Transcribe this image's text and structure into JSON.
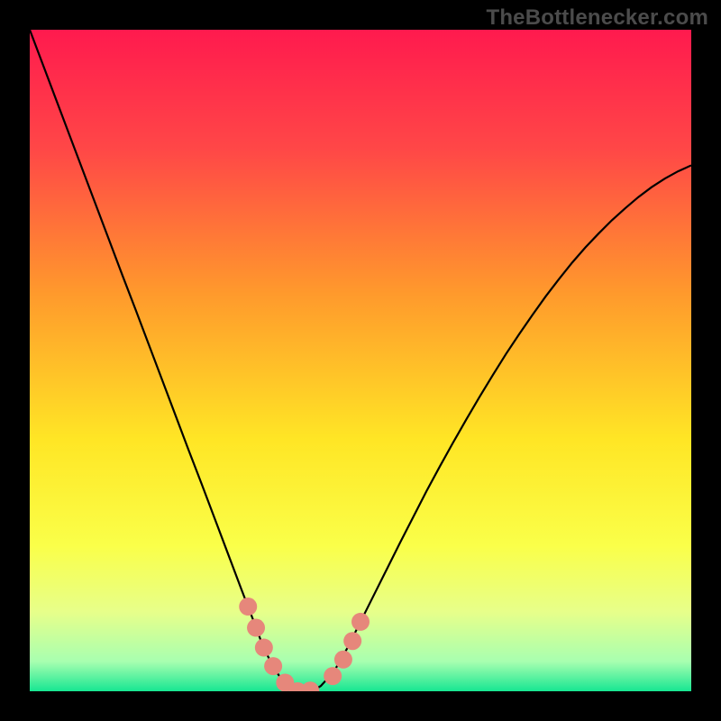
{
  "watermark": "TheBottlenecker.com",
  "chart_data": {
    "type": "line",
    "title": "",
    "xlabel": "",
    "ylabel": "",
    "xlim": [
      0,
      100
    ],
    "ylim": [
      0,
      100
    ],
    "grid": false,
    "legend": false,
    "background_gradient": {
      "stops": [
        {
          "offset": 0.0,
          "color": "#ff1a4e"
        },
        {
          "offset": 0.18,
          "color": "#ff4747"
        },
        {
          "offset": 0.4,
          "color": "#ff9a2c"
        },
        {
          "offset": 0.62,
          "color": "#ffe625"
        },
        {
          "offset": 0.78,
          "color": "#faff49"
        },
        {
          "offset": 0.88,
          "color": "#e7ff8a"
        },
        {
          "offset": 0.955,
          "color": "#a8ffb0"
        },
        {
          "offset": 1.0,
          "color": "#17e692"
        }
      ]
    },
    "series": [
      {
        "name": "bottleneck-curve",
        "color": "#000000",
        "width": 2.2,
        "x": [
          0,
          2,
          4,
          6,
          8,
          10,
          12,
          14,
          16,
          18,
          20,
          22,
          24,
          26,
          28,
          30,
          32,
          34,
          35,
          36,
          37,
          38,
          39,
          40,
          41,
          42,
          43,
          44,
          46,
          48,
          50,
          52,
          54,
          56,
          58,
          60,
          62,
          64,
          66,
          68,
          70,
          72,
          74,
          76,
          78,
          80,
          82,
          84,
          86,
          88,
          90,
          92,
          94,
          96,
          98,
          100
        ],
        "y": [
          100,
          94.7,
          89.4,
          84.1,
          78.8,
          73.5,
          68.2,
          62.9,
          57.7,
          52.4,
          47.1,
          41.8,
          36.5,
          31.3,
          26.0,
          20.7,
          15.4,
          10.2,
          7.5,
          5.3,
          3.4,
          1.9,
          0.8,
          0.2,
          0.0,
          0.0,
          0.2,
          0.8,
          3.0,
          6.5,
          10.5,
          14.5,
          18.5,
          22.5,
          26.4,
          30.3,
          34.0,
          37.6,
          41.1,
          44.5,
          47.8,
          51.0,
          54.0,
          56.9,
          59.7,
          62.3,
          64.8,
          67.1,
          69.2,
          71.2,
          73.0,
          74.7,
          76.2,
          77.5,
          78.6,
          79.5
        ]
      }
    ],
    "markers": {
      "name": "salmon-dots",
      "color": "#e6877b",
      "radius": 10,
      "points": [
        {
          "x": 33.0,
          "y": 12.8
        },
        {
          "x": 34.2,
          "y": 9.6
        },
        {
          "x": 35.4,
          "y": 6.6
        },
        {
          "x": 36.8,
          "y": 3.8
        },
        {
          "x": 38.6,
          "y": 1.3
        },
        {
          "x": 40.5,
          "y": 0.0
        },
        {
          "x": 42.4,
          "y": 0.1
        },
        {
          "x": 45.8,
          "y": 2.3
        },
        {
          "x": 47.4,
          "y": 4.8
        },
        {
          "x": 48.8,
          "y": 7.6
        },
        {
          "x": 50.0,
          "y": 10.5
        }
      ]
    }
  }
}
